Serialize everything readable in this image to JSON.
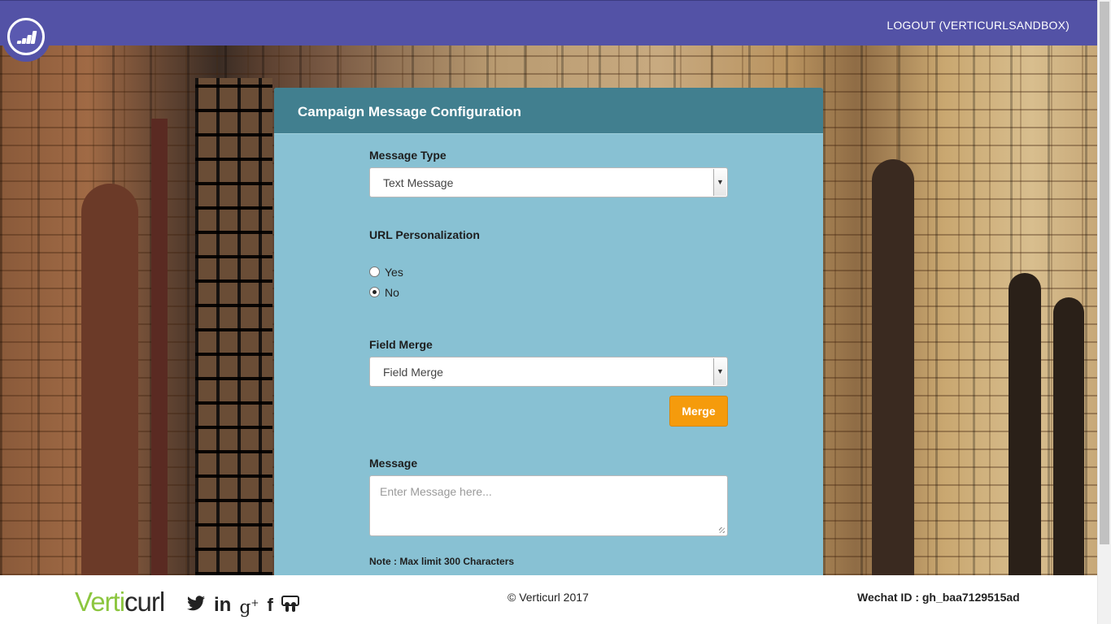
{
  "header": {
    "logout_label": "LOGOUT (VERTICURLSANDBOX)"
  },
  "panel": {
    "title": "Campaign Message Configuration",
    "message_type": {
      "label": "Message Type",
      "selected": "Text Message"
    },
    "url_personalization": {
      "label": "URL Personalization",
      "options": [
        {
          "label": "Yes",
          "checked": false
        },
        {
          "label": "No",
          "checked": true
        }
      ]
    },
    "field_merge": {
      "label": "Field Merge",
      "selected": "Field Merge",
      "button_label": "Merge"
    },
    "message": {
      "label": "Message",
      "placeholder": "Enter Message here..."
    },
    "note": "Note : Max limit 300 Characters"
  },
  "footer": {
    "brand_part1": "Verti",
    "brand_part2": "curl",
    "social_icons": [
      "twitter-icon",
      "linkedin-icon",
      "google-plus-icon",
      "facebook-icon",
      "slideshare-icon"
    ],
    "copyright": "© Verticurl 2017",
    "wechat": "Wechat ID : gh_baa7129515ad"
  },
  "colors": {
    "topbar": "#5352a6",
    "panel_header": "#417f8f",
    "panel_body": "#88c1d3",
    "merge_button": "#f59b0c",
    "brand_green": "#8cc63f"
  }
}
